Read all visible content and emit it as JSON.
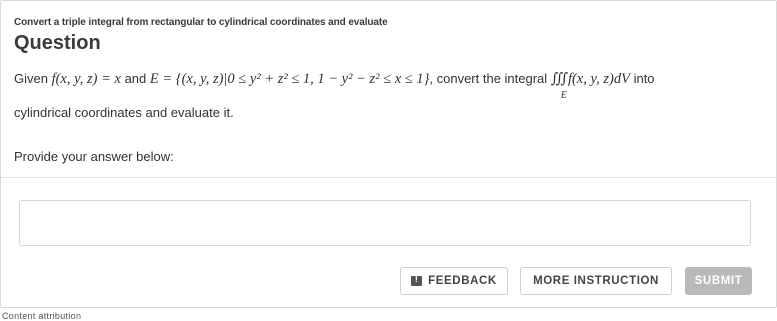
{
  "header": {
    "subtitle": "Convert a triple integral from rectangular to cylindrical coordinates and evaluate",
    "title": "Question"
  },
  "question": {
    "given_prefix": "Given ",
    "func": "f(x, y, z) = x",
    "and_word": " and ",
    "set_def": "E = {(x, y, z)|0 ≤ y² + z² ≤ 1, 1 − y² − z² ≤ x ≤ 1}",
    "convert_text": ", convert the integral ",
    "integral_symbol": "∭",
    "integrand": "f(x, y, z)dV",
    "integral_region": "E",
    "into_text": " into",
    "line2": "cylindrical coordinates and evaluate it."
  },
  "answer": {
    "prompt": "Provide your answer below:",
    "value": ""
  },
  "buttons": {
    "feedback": "FEEDBACK",
    "more_instruction": "MORE INSTRUCTION",
    "submit": "SUBMIT"
  },
  "footer": {
    "attribution": "Content attribution"
  }
}
